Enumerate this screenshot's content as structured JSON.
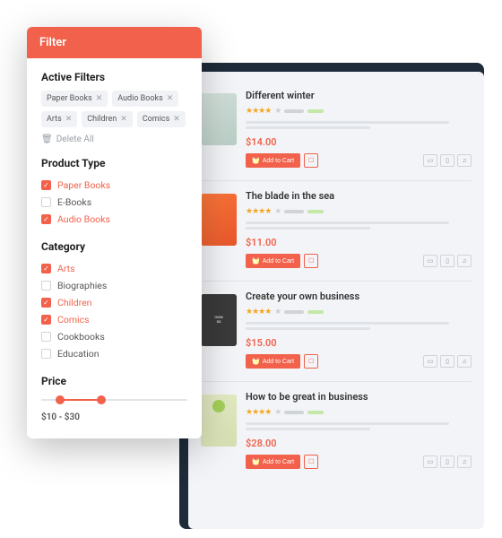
{
  "filter": {
    "header": "Filter",
    "active_title": "Active Filters",
    "chips": [
      "Paper Books",
      "Audio Books",
      "Arts",
      "Children",
      "Comics"
    ],
    "delete_all": "Delete All",
    "product_type_title": "Product Type",
    "product_types": [
      {
        "label": "Paper Books",
        "checked": true
      },
      {
        "label": "E-Books",
        "checked": false
      },
      {
        "label": "Audio Books",
        "checked": true
      }
    ],
    "category_title": "Category",
    "categories": [
      {
        "label": "Arts",
        "checked": true
      },
      {
        "label": "Biographies",
        "checked": false
      },
      {
        "label": "Children",
        "checked": true
      },
      {
        "label": "Comics",
        "checked": true
      },
      {
        "label": "Cookbooks",
        "checked": false
      },
      {
        "label": "Education",
        "checked": false
      }
    ],
    "price_title": "Price",
    "price_range": "$10 - $30"
  },
  "products": [
    {
      "title": "Different winter",
      "price": "$14.00",
      "addcart": "Add to Cart"
    },
    {
      "title": "The blade in the sea",
      "price": "$11.00",
      "addcart": "Add to Cart"
    },
    {
      "title": "Create your own business",
      "price": "$15.00",
      "addcart": "Add to Cart"
    },
    {
      "title": "How to be great in business",
      "price": "$28.00",
      "addcart": "Add to Cart"
    }
  ]
}
